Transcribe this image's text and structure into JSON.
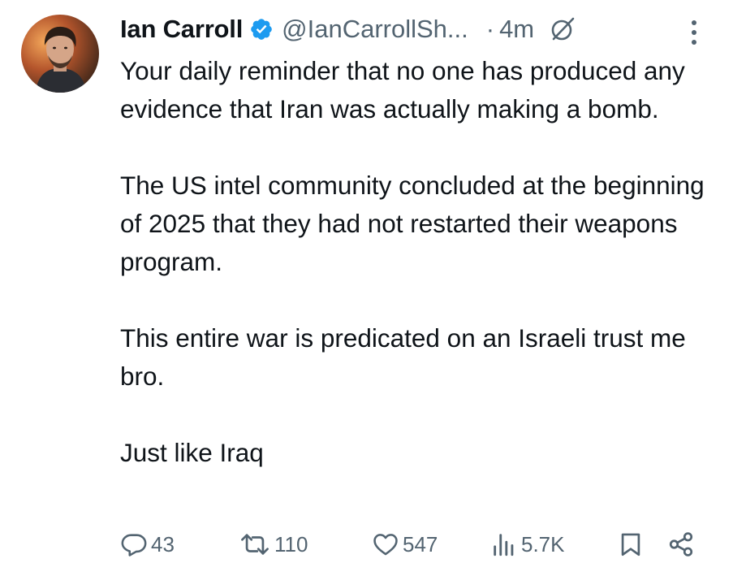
{
  "tweet": {
    "author": {
      "display_name": "Ian Carroll",
      "handle": "@IanCarrollSh...",
      "verified": true,
      "avatar_icon": "avatar-photo"
    },
    "separator": "·",
    "time_ago": "4m",
    "paragraphs": [
      "Your daily reminder that no one has produced any evidence that Iran was actually making a bomb.",
      "The US intel community concluded at the beginning of 2025 that they had not restarted their weapons program.",
      "This entire war is predicated on an Israeli trust me bro.",
      "Just like Iraq"
    ],
    "actions": {
      "replies": "43",
      "reposts": "110",
      "likes": "547",
      "views": "5.7K"
    }
  },
  "colors": {
    "text": "#0f1419",
    "muted": "#536471",
    "verified_badge": "#1d9bf0"
  },
  "icons": [
    "verified-badge-icon",
    "grok-icon",
    "more-options-icon",
    "reply-icon",
    "repost-icon",
    "like-icon",
    "views-icon",
    "bookmark-icon",
    "share-icon"
  ]
}
